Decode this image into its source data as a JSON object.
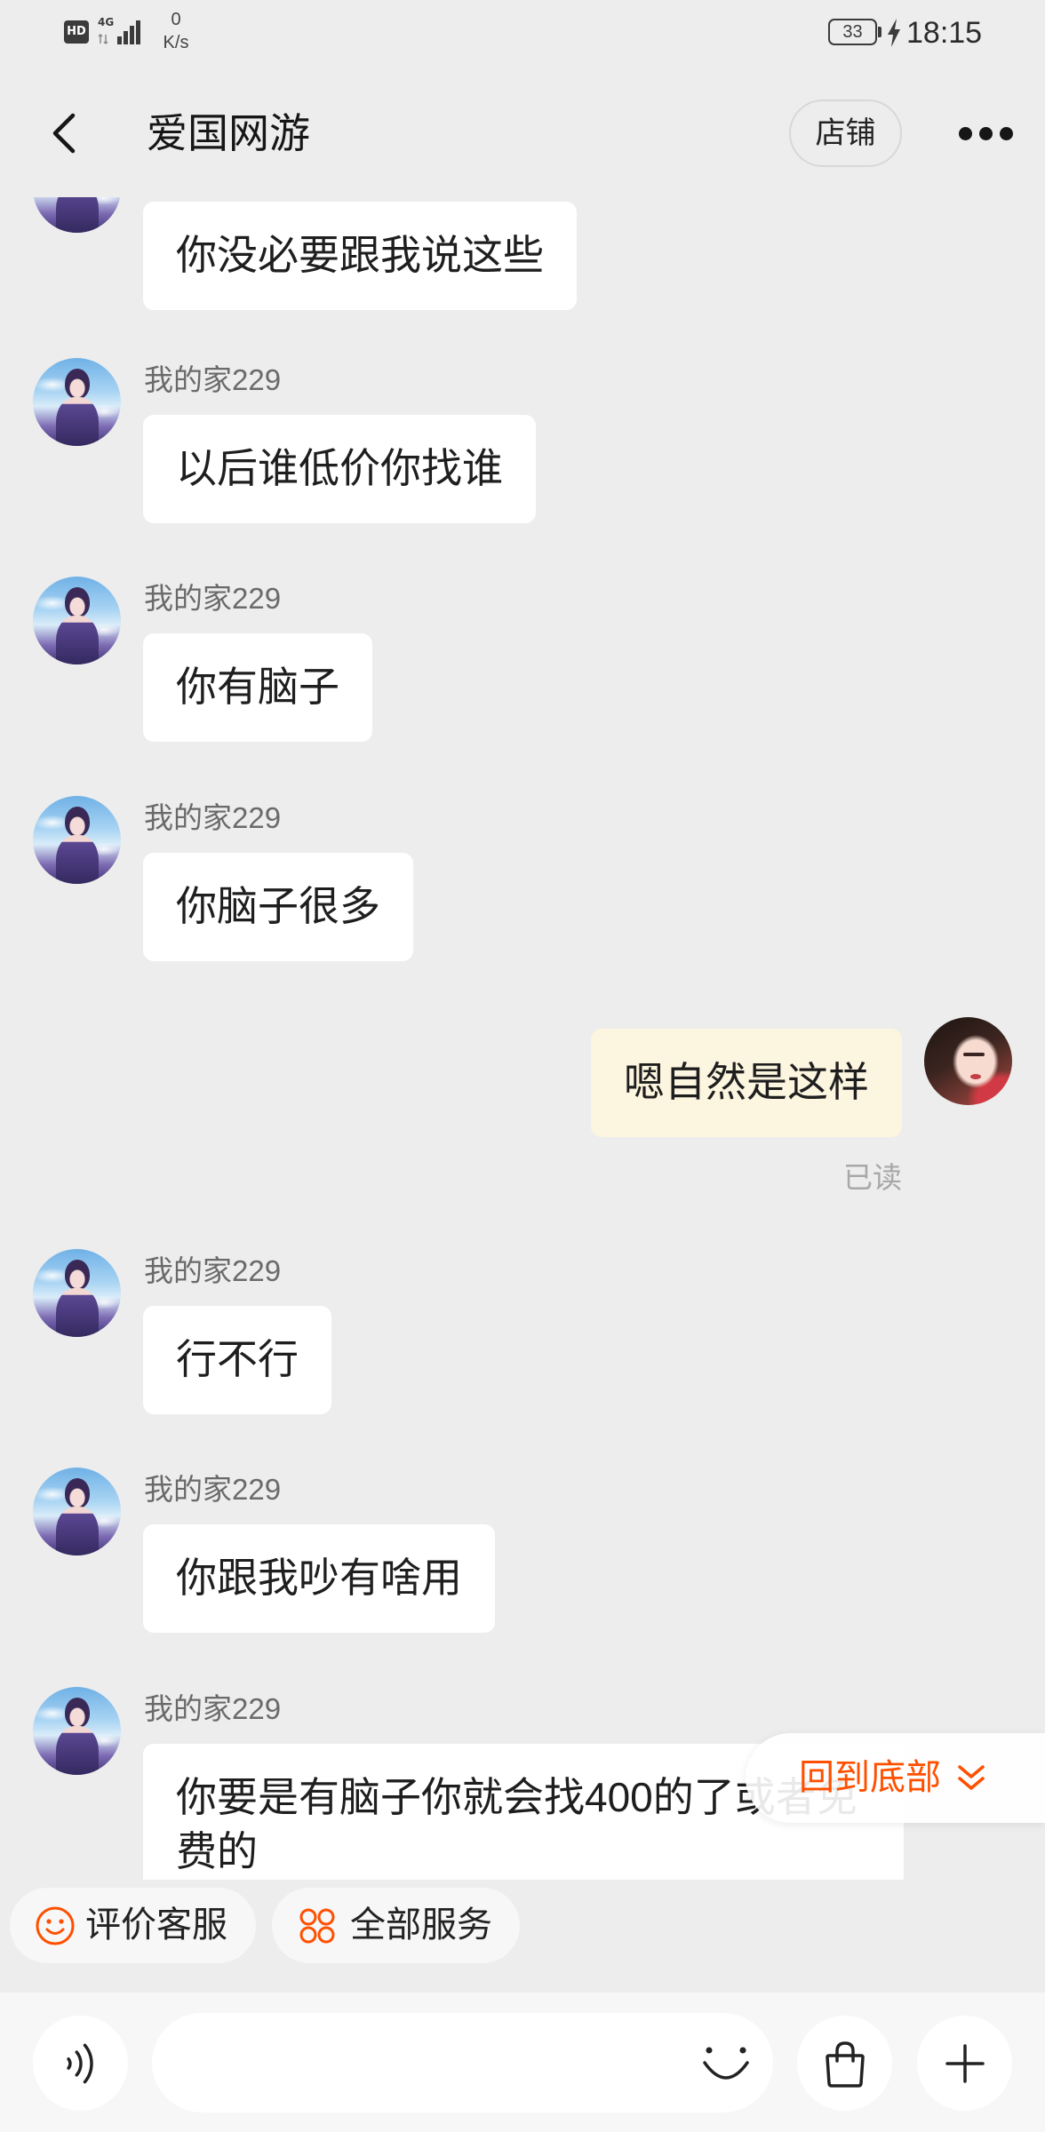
{
  "status_bar": {
    "hd_label": "HD",
    "network_label": "4G",
    "speed_value": "0",
    "speed_unit": "K/s",
    "battery_level": "33",
    "time": "18:15",
    "icons": {
      "signal": "signal-bars-icon",
      "battery": "battery-icon",
      "charging": "charging-bolt-icon"
    }
  },
  "header": {
    "title": "爱国网游",
    "store_button_label": "店铺",
    "icons": {
      "back": "chevron-left-icon",
      "more": "more-dots-icon"
    }
  },
  "messages": [
    {
      "text": "你没必要跟我说这些"
    },
    {
      "sender": "我的家229",
      "text": "以后谁低价你找谁"
    },
    {
      "sender": "我的家229",
      "text": "你有脑子"
    },
    {
      "sender": "我的家229",
      "text": "你脑子很多"
    },
    {
      "text": "嗯自然是这样",
      "read_status": "已读"
    },
    {
      "sender": "我的家229",
      "text": "行不行"
    },
    {
      "sender": "我的家229",
      "text": "你跟我吵有啥用"
    },
    {
      "sender": "我的家229",
      "text": "你要是有脑子你就会找400的了或者免费的"
    }
  ],
  "jump_to_bottom": {
    "label": "回到底部",
    "icon": "double-chevron-down-icon"
  },
  "quick_actions": [
    {
      "label": "评价客服",
      "icon": "smiley-icon"
    },
    {
      "label": "全部服务",
      "icon": "four-circles-grid-icon"
    }
  ],
  "input_bar": {
    "message_value": "",
    "icons": {
      "voice": "voice-icon",
      "emoji": "emoji-icon",
      "shop": "shopping-bag-icon",
      "more": "plus-icon"
    }
  },
  "colors": {
    "accent": "#ff5000",
    "page_background": "#ededed",
    "incoming_bubble": "#ffffff",
    "outgoing_bubble": "#fcf5df",
    "read_status": "#a8a8a8"
  }
}
